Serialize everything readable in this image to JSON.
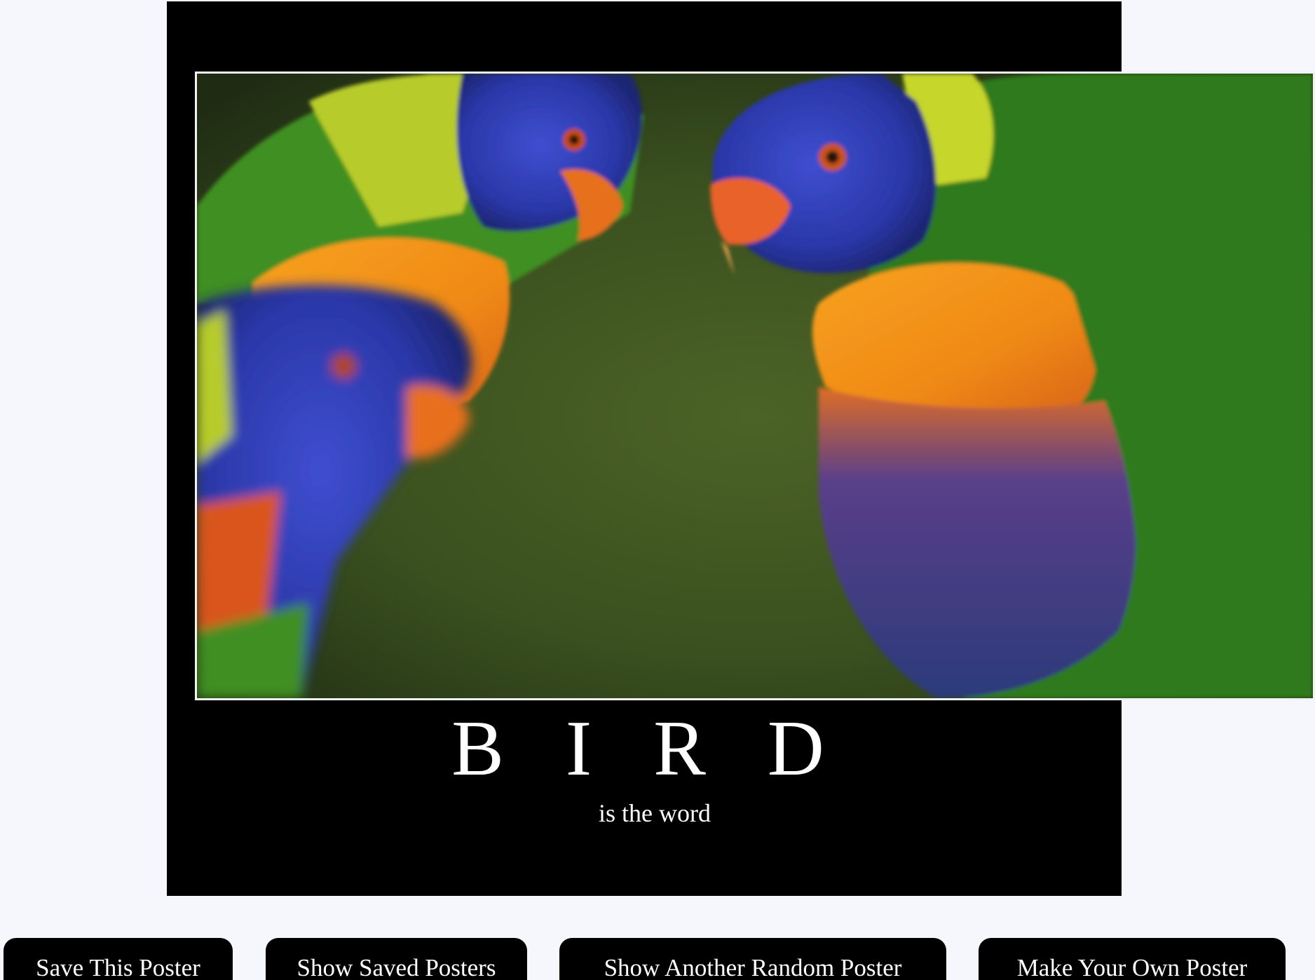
{
  "poster": {
    "image_description_icon": "lorikeets-photo",
    "title": "B I R D",
    "quote": "is the word"
  },
  "buttons": {
    "save": "Save This Poster",
    "show_saved": "Show Saved Posters",
    "random": "Show Another Random Poster",
    "make_own": "Make Your Own Poster"
  },
  "colors": {
    "page_background": "#f6f7fc",
    "poster_background": "#000000",
    "button_background": "#000000",
    "text": "#ffffff"
  }
}
